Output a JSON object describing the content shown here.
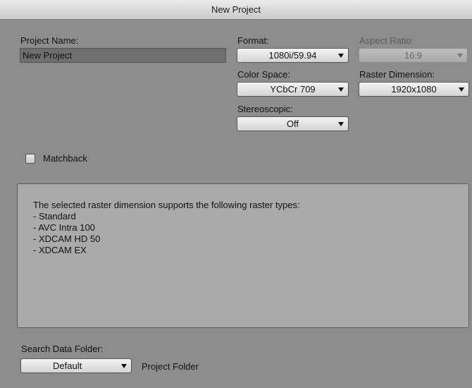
{
  "window": {
    "title": "New Project"
  },
  "project_name": {
    "label": "Project Name:",
    "value": "New Project"
  },
  "format": {
    "label": "Format:",
    "value": "1080i/59.94"
  },
  "aspect_ratio": {
    "label": "Aspect Ratio:",
    "value": "16:9"
  },
  "color_space": {
    "label": "Color Space:",
    "value": "YCbCr 709"
  },
  "raster_dimension": {
    "label": "Raster Dimension:",
    "value": "1920x1080"
  },
  "stereoscopic": {
    "label": "Stereoscopic:",
    "value": "Off"
  },
  "matchback": {
    "label": "Matchback",
    "checked": false
  },
  "info": {
    "heading": "The selected raster dimension supports the following raster types:",
    "items": [
      "- Standard",
      "- AVC Intra 100",
      "- XDCAM HD 50",
      "- XDCAM EX"
    ]
  },
  "search_data_folder": {
    "label": "Search Data Folder:",
    "value": "Default",
    "side_label": "Project Folder"
  },
  "colors": {
    "background": "#8d8d8d",
    "titlebar": "#d9d9d9",
    "info_box": "#aaaaaa"
  }
}
